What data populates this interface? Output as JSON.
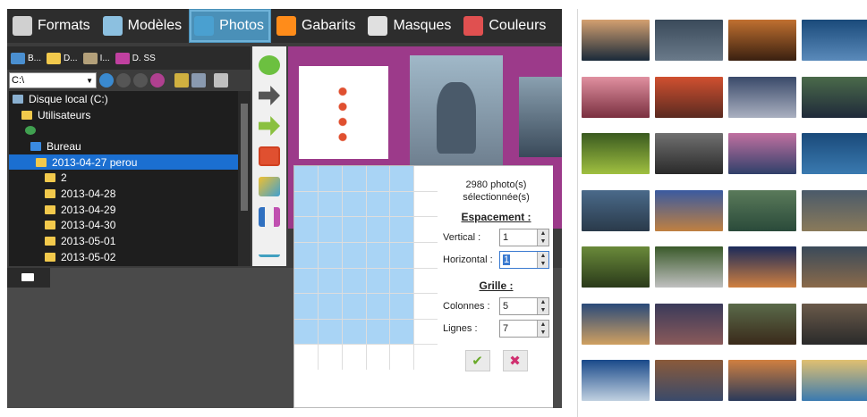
{
  "tabs": [
    {
      "label": "Formats",
      "icon": "formats-icon",
      "color": "#d0d0d0"
    },
    {
      "label": "Modèles",
      "icon": "models-icon",
      "color": "#8cc0e0"
    },
    {
      "label": "Photos",
      "icon": "photos-icon",
      "color": "#4aa0d0",
      "active": true
    },
    {
      "label": "Gabarits",
      "icon": "templates-icon",
      "color": "#ff8c1a"
    },
    {
      "label": "Masques",
      "icon": "masks-icon",
      "color": "#e0e0e0"
    },
    {
      "label": "Couleurs",
      "icon": "colors-icon",
      "color": "#e05050"
    }
  ],
  "toolbar": {
    "items": [
      {
        "label": "B...",
        "icon": "desktop-icon",
        "color": "#4a8fd0"
      },
      {
        "label": "D...",
        "icon": "folder-icon",
        "color": "#f2c94c"
      },
      {
        "label": "I...",
        "icon": "images-folder-icon",
        "color": "#b3a07a"
      },
      {
        "label": "D. SS",
        "icon": "user-icon",
        "color": "#c040a0"
      }
    ]
  },
  "path": {
    "drive": "C:\\"
  },
  "tree": [
    {
      "label": "Disque local (C:)",
      "indent": 4,
      "icon": "drive"
    },
    {
      "label": "Utilisateurs",
      "indent": 14,
      "icon": "folder"
    },
    {
      "label": "",
      "indent": 18,
      "icon": "user"
    },
    {
      "label": "Bureau",
      "indent": 24,
      "icon": "desktop"
    },
    {
      "label": "2013-04-27 perou",
      "indent": 30,
      "icon": "folder",
      "selected": true
    },
    {
      "label": "2",
      "indent": 40,
      "icon": "folder"
    },
    {
      "label": "2013-04-28",
      "indent": 40,
      "icon": "folder"
    },
    {
      "label": "2013-04-29",
      "indent": 40,
      "icon": "folder"
    },
    {
      "label": "2013-04-30",
      "indent": 40,
      "icon": "folder"
    },
    {
      "label": "2013-05-01",
      "indent": 40,
      "icon": "folder"
    },
    {
      "label": "2013-05-02",
      "indent": 40,
      "icon": "folder"
    }
  ],
  "panel": {
    "count": "2980 photo(s)\nsélectionnée(s)",
    "spacing_title": "Espacement :",
    "vertical_label": "Vertical :",
    "vertical": "1",
    "horizontal_label": "Horizontal :",
    "horizontal": "1",
    "grid_title": "Grille :",
    "columns_label": "Colonnes :",
    "columns": "5",
    "rows_label": "Lignes :",
    "rows": "7"
  },
  "gallery": {
    "colors": [
      [
        "#d4a070",
        "#1a2a3a"
      ],
      [
        "#3a4a5a",
        "#6a7a8a"
      ],
      [
        "#c07030",
        "#3a2010"
      ],
      [
        "#1a4a7a",
        "#5a8aba"
      ],
      [
        "#e090a0",
        "#7a3040"
      ],
      [
        "#d05030",
        "#5a2a20"
      ],
      [
        "#3a4a6a",
        "#aab0c0"
      ],
      [
        "#4a6a4a",
        "#202a3a"
      ],
      [
        "#3a5a20",
        "#a0c040"
      ],
      [
        "#707070",
        "#2a2a2a"
      ],
      [
        "#c070a0",
        "#30406a"
      ],
      [
        "#1a4a7a",
        "#3a7ab0"
      ],
      [
        "#4a6a8a",
        "#2a3a4a"
      ],
      [
        "#3a5aa0",
        "#c08040"
      ],
      [
        "#5a7a5a",
        "#2a4a3a"
      ],
      [
        "#4a5a6a",
        "#8a7a5a"
      ],
      [
        "#6a8a3a",
        "#2a3a1a"
      ],
      [
        "#3a5a2a",
        "#c0c0c0"
      ],
      [
        "#1a2a5a",
        "#d08040"
      ],
      [
        "#3a4a5a",
        "#8a6a4a"
      ],
      [
        "#2a4a7a",
        "#d0a060"
      ],
      [
        "#3a3a5a",
        "#8a5a5a"
      ],
      [
        "#5a6a4a",
        "#3a2a1a"
      ],
      [
        "#6a5a4a",
        "#2a2a2a"
      ],
      [
        "#1a4a8a",
        "#c0d0e0"
      ],
      [
        "#8a5a3a",
        "#3a4a6a"
      ],
      [
        "#d08040",
        "#2a3a5a"
      ],
      [
        "#e0c070",
        "#3a7ab0"
      ]
    ]
  }
}
